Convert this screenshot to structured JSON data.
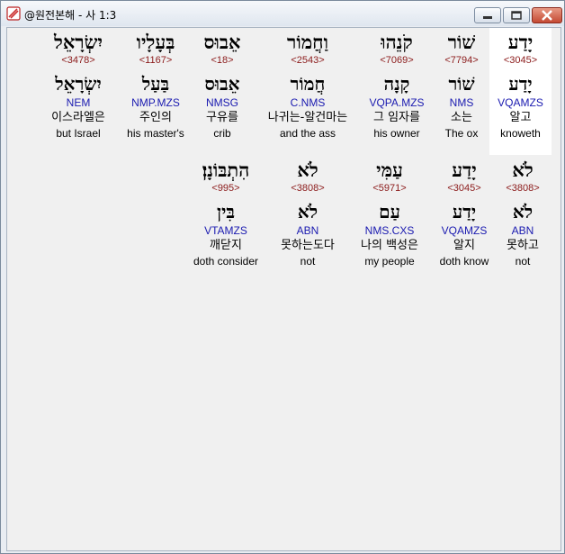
{
  "window": {
    "title": "@원전본해 - 사 1:3"
  },
  "row1": [
    {
      "hebrew": "יָדַע",
      "strong": "<3045>",
      "lemma": "יָדַע",
      "parse": "VQAMZS",
      "korean": "알고",
      "english": "knoweth"
    },
    {
      "hebrew": "שׁוֹר",
      "strong": "<7794>",
      "lemma": "שׁוֹר",
      "parse": "NMS",
      "korean": "소는",
      "english": "The ox"
    },
    {
      "hebrew": "קֹנֵהוּ",
      "strong": "<7069>",
      "lemma": "קָנָה",
      "parse": "VQPA.MZS",
      "korean": "그 임자를",
      "english": "his owner"
    },
    {
      "hebrew": "וַחֲמוֹר",
      "strong": "<2543>",
      "lemma": "חֲמוֹר",
      "parse": "C.NMS",
      "korean": "나귀는-알건마는",
      "english": "and the ass"
    },
    {
      "hebrew": "אֵבוּס",
      "strong": "<18>",
      "lemma": "אֵבוּס",
      "parse": "NMSG",
      "korean": "구유를",
      "english": "crib"
    },
    {
      "hebrew": "בְּעָלָיו",
      "strong": "<1167>",
      "lemma": "בַּעַל",
      "parse": "NMP.MZS",
      "korean": "주인의",
      "english": "his master's"
    },
    {
      "hebrew": "יִשְׂרָאֵל",
      "strong": "<3478>",
      "lemma": "יִשְׂרָאֵל",
      "parse": "NEM",
      "korean": "이스라엘은",
      "english": "but Israel"
    }
  ],
  "row2": [
    {
      "hebrew": "לֹא",
      "strong": "<3808>",
      "lemma": "לֹא",
      "parse": "ABN",
      "korean": "못하고",
      "english": "not"
    },
    {
      "hebrew": "יָדַע",
      "strong": "<3045>",
      "lemma": "יָדַע",
      "parse": "VQAMZS",
      "korean": "알지",
      "english": "doth know"
    },
    {
      "hebrew": "עַמִּי",
      "strong": "<5971>",
      "lemma": "עַם",
      "parse": "NMS.CXS",
      "korean": "나의 백성은",
      "english": "my people"
    },
    {
      "hebrew": "לֹא",
      "strong": "<3808>",
      "lemma": "לֹא",
      "parse": "ABN",
      "korean": "못하는도다",
      "english": "not"
    },
    {
      "hebrew": "הִתְבּוֹנָן׃",
      "strong": "<995>",
      "lemma": "בִּין",
      "parse": "VTAMZS",
      "korean": "깨닫지",
      "english": "doth consider"
    }
  ]
}
